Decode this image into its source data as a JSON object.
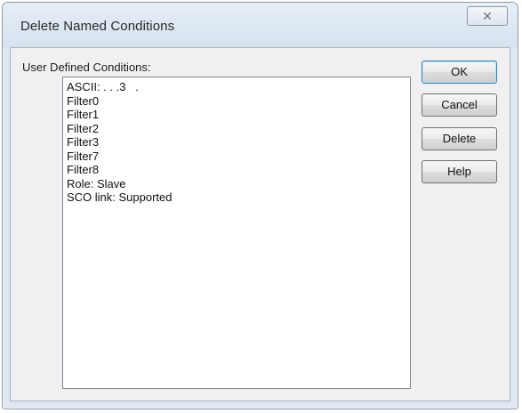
{
  "window": {
    "title": "Delete Named Conditions",
    "close_glyph": "✕",
    "close_icon": "close-icon"
  },
  "list": {
    "label": "User Defined Conditions:",
    "items": [
      "ASCII: . . .3   .",
      "Filter0",
      "Filter1",
      "Filter2",
      "Filter3",
      "Filter7",
      "Filter8",
      "Role: Slave",
      "SCO link: Supported"
    ]
  },
  "buttons": {
    "ok": "OK",
    "cancel": "Cancel",
    "delete": "Delete",
    "help": "Help"
  }
}
